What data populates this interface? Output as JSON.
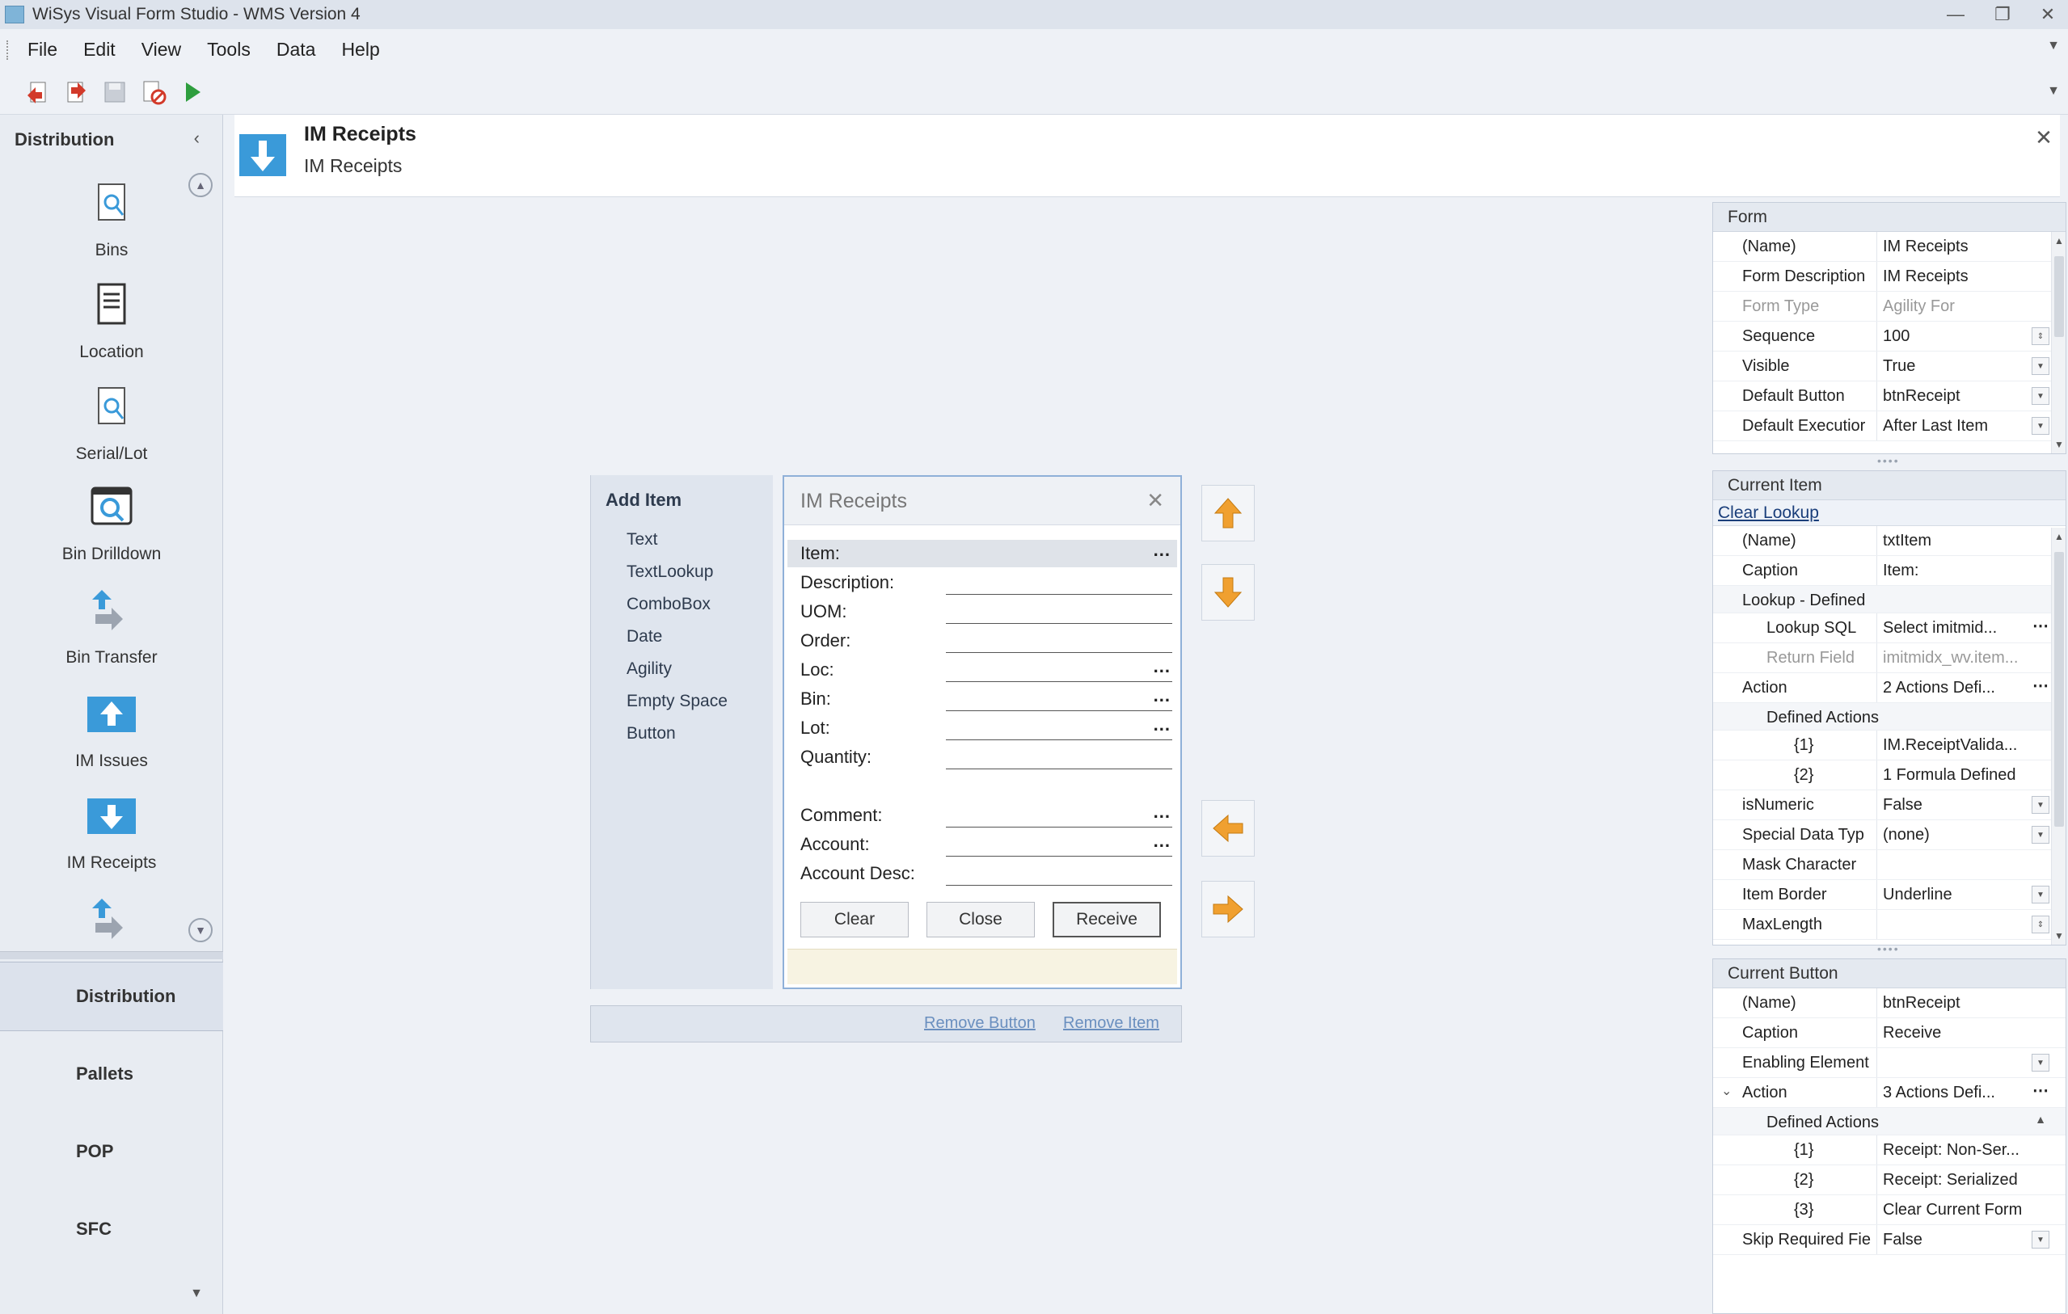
{
  "window": {
    "title": "WiSys Visual Form Studio - WMS Version 4",
    "minimize": "—",
    "restore": "❐",
    "close": "✕"
  },
  "menu": [
    "File",
    "Edit",
    "View",
    "Tools",
    "Data",
    "Help"
  ],
  "toolbar": [
    "undo-icon",
    "redo-icon",
    "save-icon",
    "delete-icon",
    "run-icon"
  ],
  "nav": {
    "header": "Distribution",
    "collapse": "‹",
    "items": [
      {
        "label": "Bins",
        "icon": "bins-icon"
      },
      {
        "label": "Location",
        "icon": "location-icon"
      },
      {
        "label": "Serial/Lot",
        "icon": "serial-lot-icon"
      },
      {
        "label": "Bin Drilldown",
        "icon": "bin-drilldown-icon"
      },
      {
        "label": "Bin Transfer",
        "icon": "bin-transfer-icon"
      },
      {
        "label": "IM Issues",
        "icon": "im-issues-icon"
      },
      {
        "label": "IM Receipts",
        "icon": "im-receipts-icon"
      }
    ],
    "sections": [
      "Distribution",
      "Pallets",
      "POP",
      "SFC"
    ]
  },
  "header": {
    "title": "IM Receipts",
    "subtitle": "IM Receipts",
    "close": "✕"
  },
  "add_item": {
    "title": "Add Item",
    "options": [
      "Text",
      "TextLookup",
      "ComboBox",
      "Date",
      "Agility",
      "Empty Space",
      "Button"
    ]
  },
  "form_preview": {
    "title": "IM Receipts",
    "close": "✕",
    "fields": [
      {
        "label": "Item:",
        "lookup": true,
        "selected": true
      },
      {
        "label": "Description:",
        "lookup": false
      },
      {
        "label": "UOM:",
        "lookup": false
      },
      {
        "label": "Order:",
        "lookup": false
      },
      {
        "label": "Loc:",
        "lookup": true
      },
      {
        "label": "Bin:",
        "lookup": true
      },
      {
        "label": "Lot:",
        "lookup": true
      },
      {
        "label": "Quantity:",
        "lookup": false
      },
      {
        "label": "Comment:",
        "lookup": true
      },
      {
        "label": "Account:",
        "lookup": true
      },
      {
        "label": "Account Desc:",
        "lookup": false
      }
    ],
    "buttons": {
      "clear": "Clear",
      "close": "Close",
      "receive": "Receive"
    },
    "ellipsis": "..."
  },
  "links": {
    "remove_button": "Remove Button",
    "remove_item": "Remove Item"
  },
  "form_props": {
    "header": "Form",
    "rows": [
      {
        "k": "(Name)",
        "v": "IM Receipts"
      },
      {
        "k": "Form Description",
        "v": "IM Receipts"
      },
      {
        "k": "Form Type",
        "v": "Agility For",
        "dim": true
      },
      {
        "k": "Sequence",
        "v": "100",
        "spin": true
      },
      {
        "k": "Visible",
        "v": "True",
        "dd": true
      },
      {
        "k": "Default Button",
        "v": "btnReceipt",
        "dd": true
      },
      {
        "k": "Default Executior",
        "v": "After Last Item",
        "dd": true
      }
    ]
  },
  "item_props": {
    "header": "Current Item",
    "link": "Clear Lookup",
    "rows": [
      {
        "k": "(Name)",
        "v": "txtItem"
      },
      {
        "k": "Caption",
        "v": "Item:"
      },
      {
        "k": "Lookup - Defined",
        "v": "",
        "group": true
      },
      {
        "k": "Lookup SQL",
        "v": "Select imitmid...",
        "sub": true,
        "dots": true
      },
      {
        "k": "Return Field",
        "v": "imitmidx_wv.item...",
        "sub": true,
        "dim": true
      },
      {
        "k": "Action",
        "v": "2 Actions Defi...",
        "dots": true
      },
      {
        "k": "Defined Actions",
        "v": "",
        "group": true,
        "sub": true
      },
      {
        "k": "{1}",
        "v": "IM.ReceiptValida...",
        "sub2": true
      },
      {
        "k": "{2}",
        "v": "1 Formula Defined",
        "sub2": true
      },
      {
        "k": "isNumeric",
        "v": "False",
        "dd": true
      },
      {
        "k": "Special Data Typ",
        "v": "(none)",
        "dd": true
      },
      {
        "k": "Mask Character",
        "v": ""
      },
      {
        "k": "Item Border",
        "v": "Underline",
        "dd": true
      },
      {
        "k": "MaxLength",
        "v": "",
        "spin": true
      }
    ]
  },
  "button_props": {
    "header": "Current Button",
    "rows": [
      {
        "k": "(Name)",
        "v": "btnReceipt"
      },
      {
        "k": "Caption",
        "v": "Receive"
      },
      {
        "k": "Enabling Element",
        "v": "",
        "dd": true
      },
      {
        "k": "Action",
        "v": "3 Actions Defi...",
        "dots": true,
        "expand": true
      },
      {
        "k": "Defined Actions",
        "v": "",
        "group": true,
        "sub": true,
        "collapse": true
      },
      {
        "k": "{1}",
        "v": "Receipt: Non-Ser...",
        "sub2": true
      },
      {
        "k": "{2}",
        "v": "Receipt: Serialized",
        "sub2": true
      },
      {
        "k": "{3}",
        "v": "Clear Current Form",
        "sub2": true
      },
      {
        "k": "Skip Required Fie",
        "v": "False",
        "dd": true
      }
    ]
  },
  "colors": {
    "accent_blue": "#3a9ad9",
    "arrow_orange": "#f0a030",
    "link": "#1a3e7a"
  }
}
